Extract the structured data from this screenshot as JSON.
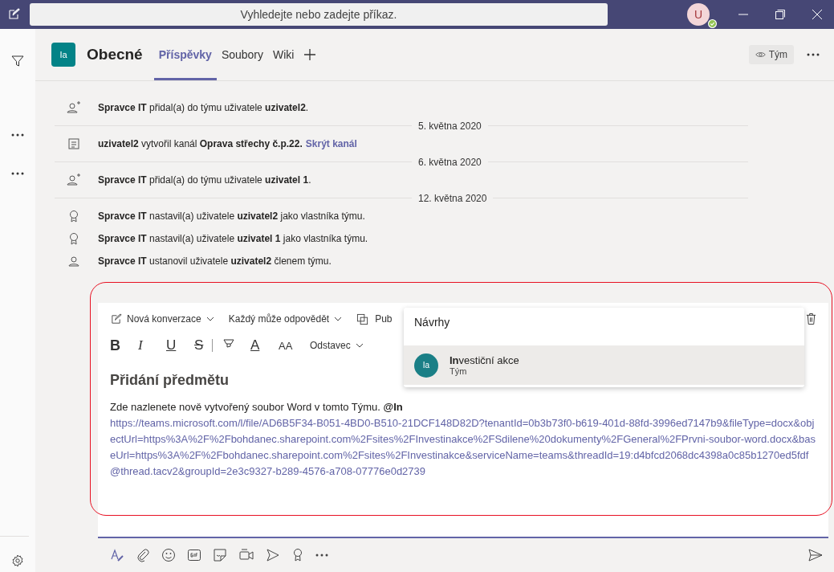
{
  "app_bar": {
    "search_placeholder": "Vyhledejte nebo zadejte příkaz.",
    "avatar_initial": "U"
  },
  "channel": {
    "avatar": "Ia",
    "name": "Obecné",
    "tabs": [
      {
        "label": "Příspěvky",
        "selected": true
      },
      {
        "label": "Soubory",
        "selected": false
      },
      {
        "label": "Wiki",
        "selected": false
      }
    ],
    "team_button": "Tým"
  },
  "feed": [
    {
      "kind": "member_added",
      "text": "**Spravce IT** přidal(a) do týmu uživatele **uzivatel2**."
    },
    {
      "kind": "date",
      "text": "5. května 2020"
    },
    {
      "kind": "channel_created",
      "text": "**uzivatel2** vytvořil kanál **Oprava střechy č.p.22.**",
      "link": "Skrýt kanál"
    },
    {
      "kind": "date",
      "text": "6. května 2020"
    },
    {
      "kind": "member_added",
      "text": "**Spravce IT** přidal(a) do týmu uživatele **uzivatel 1**."
    },
    {
      "kind": "date",
      "text": "12. května 2020"
    },
    {
      "kind": "owner_set",
      "text": "**Spravce IT** nastavil(a) uživatele **uzivatel2** jako vlastníka týmu."
    },
    {
      "kind": "owner_set",
      "text": "**Spravce IT** nastavil(a) uživatele **uzivatel 1** jako vlastníka týmu."
    },
    {
      "kind": "member_set",
      "text": "**Spravce IT** ustanovil uživatele **uzivatel2** členem týmu."
    }
  ],
  "composer": {
    "options": [
      {
        "kind": "new",
        "label": "Nová konverzace"
      },
      {
        "kind": "reply",
        "label": "Každý může odpovědět"
      },
      {
        "kind": "publish",
        "label": "Pub"
      }
    ],
    "format": [
      {
        "kind": "bold",
        "label": "B"
      },
      {
        "kind": "italic",
        "label": "I"
      },
      {
        "kind": "underline",
        "label": "U"
      },
      {
        "kind": "strike",
        "label": "S"
      },
      {
        "kind": "highlight"
      },
      {
        "kind": "color",
        "label": "A"
      },
      {
        "kind": "size",
        "label": "AA"
      }
    ],
    "paragraph_style": "Odstavec",
    "subject": "Přidání předmětu",
    "message": "Zde nazlenete nově vytvořený soubor Word v tomto Týmu. **@In**",
    "link": "https://teams.microsoft.com/l/file/AD6B5F34-B051-4BD0-B510-21DCF148D82D?tenantId=0b3b73f0-b619-401d-88fd-3996ed7147b9&fileType=docx&objectUrl=https%3A%2F%2Fbohdanec.sharepoint.com%2Fsites%2FInvestinakce%2FSdilene%20dokumenty%2FGeneral%2FPrvni-soubor-word.docx&baseUrl=https%3A%2F%2Fbohdanec.sharepoint.com%2Fsites%2FInvestinakce&serviceName=teams&threadId=19:d4bfcd2068dc4398a0c85b1270ed5fdf@thread.tacv2&groupId=2e3c9327-b289-4576-a708-07776e0d2739"
  },
  "suggestions": {
    "title": "Návrhy",
    "items": [
      {
        "avatar": "Ia",
        "name": "**In**vestiční akce",
        "subtitle": "Tým",
        "selected": true
      }
    ]
  }
}
